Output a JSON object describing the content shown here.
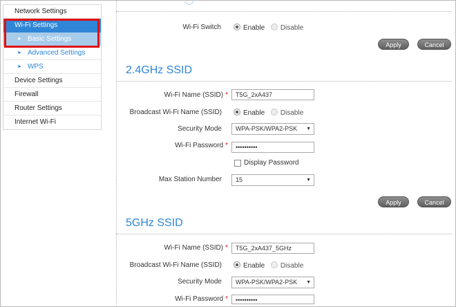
{
  "sidebar": {
    "items": [
      {
        "label": "Network Settings"
      },
      {
        "label": "Wi-Fi Settings"
      },
      {
        "label": "Basic Settings"
      },
      {
        "label": "Advanced Settings"
      },
      {
        "label": "WPS"
      },
      {
        "label": "Device Settings"
      },
      {
        "label": "Firewall"
      },
      {
        "label": "Router Settings"
      },
      {
        "label": "Internet Wi-Fi"
      }
    ]
  },
  "wifi_switch": {
    "label": "Wi-Fi Switch",
    "enable": "Enable",
    "disable": "Disable",
    "selected": "Enable"
  },
  "buttons": {
    "apply": "Apply",
    "cancel": "Cancel"
  },
  "ssid_24": {
    "title": "2.4GHz SSID",
    "name_label": "Wi-Fi Name (SSID)",
    "name_value": "T5G_2xA437",
    "broadcast_label": "Broadcast Wi-Fi Name (SSID)",
    "broadcast_enable": "Enable",
    "broadcast_disable": "Disable",
    "security_label": "Security Mode",
    "security_value": "WPA-PSK/WPA2-PSK",
    "password_label": "Wi-Fi Password",
    "password_value": "••••••••••",
    "display_password": "Display Password",
    "max_station_label": "Max Station Number",
    "max_station_value": "15"
  },
  "ssid_5": {
    "title": "5GHz SSID",
    "name_label": "Wi-Fi Name (SSID)",
    "name_value": "T5G_2xA437_5GHz",
    "broadcast_label": "Broadcast Wi-Fi Name (SSID)",
    "broadcast_enable": "Enable",
    "broadcast_disable": "Disable",
    "security_label": "Security Mode",
    "security_value": "WPA-PSK/WPA2-PSK",
    "password_label": "Wi-Fi Password",
    "password_value": "••••••••••"
  },
  "required_mark": "*",
  "colors": {
    "accent": "#2f86d6",
    "highlight": "#e01010",
    "selected_sub": "#a7cbea"
  }
}
